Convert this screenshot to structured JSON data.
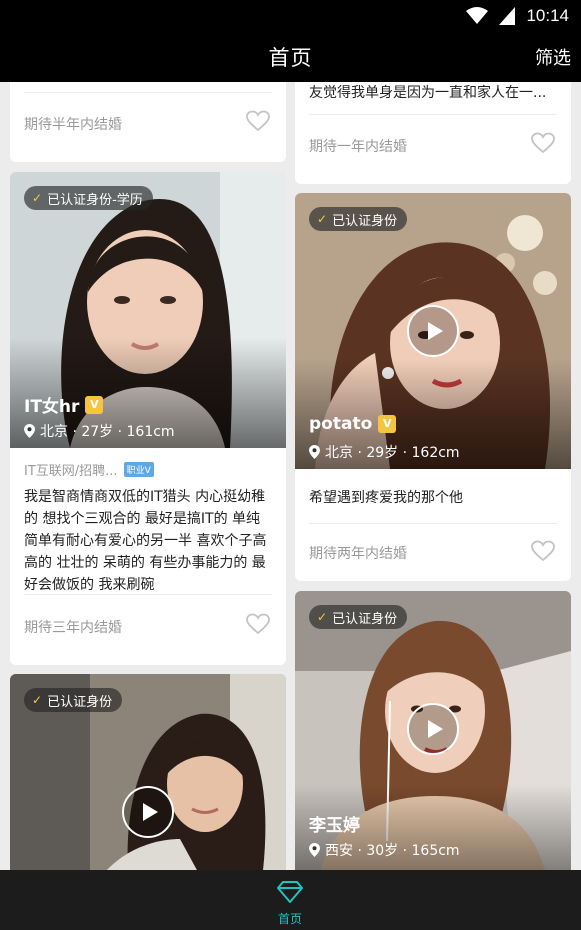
{
  "status_bar": {
    "time": "10:14",
    "icons": [
      "wifi-icon",
      "battery-icon"
    ]
  },
  "app_bar": {
    "title": "首页",
    "filter_label": "筛选"
  },
  "colors": {
    "accent": "#22c1c3",
    "verified_check": "#f2c94c",
    "vip": "#f5c542",
    "job_tag": "#5fa8e6"
  },
  "cards": [
    {
      "bio_partial": "",
      "expect": "期待半年内结婚"
    },
    {
      "bio_partial": "友觉得我单身是因为一直和家人在一...",
      "expect": "期待一年内结婚"
    },
    {
      "badge": "已认证身份-学历",
      "name": "IT女hr",
      "location": "北京 · 27岁 · 161cm",
      "job": "IT互联网/招聘...",
      "job_tag": "职业V",
      "bio": "我是智商情商双低的IT猎头 内心挺幼稚的 想找个三观合的 最好是搞IT的 单纯简单有耐心有爱心的另一半 喜欢个子高高的 壮壮的 呆萌的 有些办事能力的 最好会做饭的 我来刷碗",
      "expect": "期待三年内结婚"
    },
    {
      "badge": "已认证身份",
      "name": "potato",
      "location": "北京 · 29岁 · 162cm",
      "bio": "希望遇到疼爱我的那个他",
      "expect": "期待两年内结婚"
    },
    {
      "badge": "已认证身份"
    },
    {
      "badge": "已认证身份",
      "name": "李玉婷",
      "location": "西安 · 30岁 · 165cm"
    }
  ],
  "bottom_nav": {
    "home_label": "首页"
  }
}
